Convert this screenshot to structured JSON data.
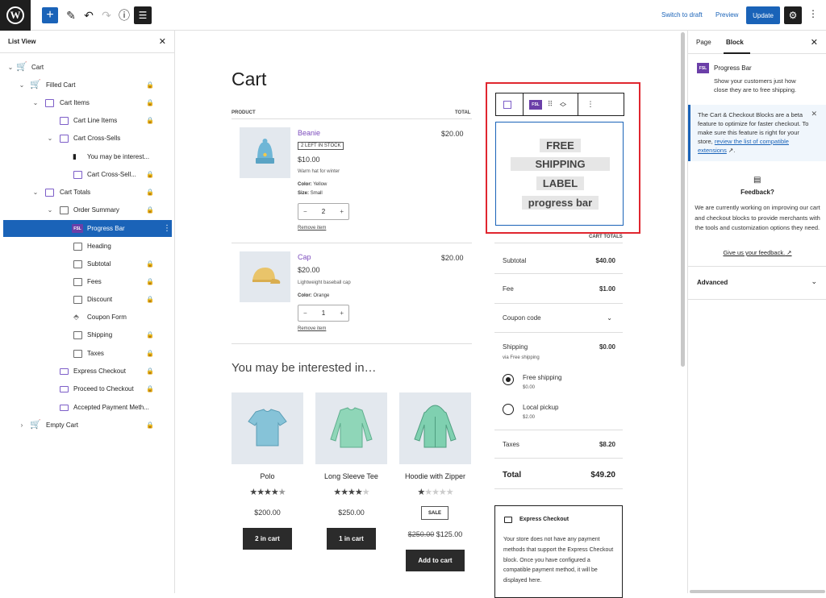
{
  "toolbar": {
    "switch_to_draft": "Switch to draft",
    "preview": "Preview",
    "update": "Update"
  },
  "list_view": {
    "title": "List View",
    "items": [
      {
        "label": "Cart"
      },
      {
        "label": "Filled Cart"
      },
      {
        "label": "Cart Items"
      },
      {
        "label": "Cart Line Items"
      },
      {
        "label": "Cart Cross-Sells"
      },
      {
        "label": "You may be interest..."
      },
      {
        "label": "Cart Cross-Sell..."
      },
      {
        "label": "Cart Totals"
      },
      {
        "label": "Order Summary"
      },
      {
        "label": "Progress Bar",
        "icon_text": "FSL"
      },
      {
        "label": "Heading"
      },
      {
        "label": "Subtotal"
      },
      {
        "label": "Fees"
      },
      {
        "label": "Discount"
      },
      {
        "label": "Coupon Form"
      },
      {
        "label": "Shipping"
      },
      {
        "label": "Taxes"
      },
      {
        "label": "Express Checkout"
      },
      {
        "label": "Proceed to Checkout"
      },
      {
        "label": "Accepted Payment Meth..."
      },
      {
        "label": "Empty Cart"
      }
    ]
  },
  "cart": {
    "title": "Cart",
    "header_product": "PRODUCT",
    "header_total": "TOTAL",
    "items": [
      {
        "name": "Beanie",
        "badge": "2 LEFT IN STOCK",
        "price": "$10.00",
        "desc": "Warm hat for winter",
        "attr1_key": "Color:",
        "attr1_val": "Yellow",
        "attr2_key": "Size:",
        "attr2_val": "Small",
        "qty": "2",
        "remove": "Remove item",
        "total": "$20.00"
      },
      {
        "name": "Cap",
        "price": "$20.00",
        "desc": "Lightweight baseball cap",
        "attr1_key": "Color:",
        "attr1_val": "Orange",
        "qty": "1",
        "remove": "Remove item",
        "total": "$20.00"
      }
    ],
    "qty_minus": "−",
    "qty_plus": "+"
  },
  "cross_sells": {
    "title": "You may be interested in…",
    "products": [
      {
        "name": "Polo",
        "rating": 4.5,
        "price": "$200.00",
        "button": "2 in cart"
      },
      {
        "name": "Long Sleeve Tee",
        "rating": 4,
        "price": "$250.00",
        "button": "1 in cart"
      },
      {
        "name": "Hoodie with Zipper",
        "rating": 1,
        "sale_badge": "SALE",
        "old_price": "$250.00",
        "price": "$125.00",
        "button": "Add to cart"
      }
    ]
  },
  "block_toolbar": {
    "icon_text": "FSL"
  },
  "progress_bar": {
    "lines": [
      "FREE",
      "SHIPPING",
      "LABEL",
      "progress bar"
    ]
  },
  "totals": {
    "heading": "CART TOTALS",
    "subtotal_label": "Subtotal",
    "subtotal": "$40.00",
    "fee_label": "Fee",
    "fee": "$1.00",
    "coupon_label": "Coupon code",
    "shipping_label": "Shipping",
    "shipping": "$0.00",
    "shipping_sub": "via Free shipping",
    "options": [
      {
        "label": "Free shipping",
        "price": "$0.00",
        "selected": true
      },
      {
        "label": "Local pickup",
        "price": "$2.00",
        "selected": false
      }
    ],
    "taxes_label": "Taxes",
    "taxes": "$8.20",
    "total_label": "Total",
    "total": "$49.20"
  },
  "express": {
    "title": "Express Checkout",
    "text": "Your store does not have any payment methods that support the Express Checkout block. Once you have configured a compatible payment method, it will be displayed here."
  },
  "sidebar": {
    "tab_page": "Page",
    "tab_block": "Block",
    "block_icon_text": "FSL",
    "block_title": "Progress Bar",
    "block_desc": "Show your customers just how close they are to free shipping.",
    "notice_text": "The Cart & Checkout Blocks are a beta feature to optimize for faster checkout. To make sure this feature is right for your store,",
    "notice_link": "review the list of compatible extensions",
    "feedback_title": "Feedback?",
    "feedback_text": "We are currently working on improving our cart and checkout blocks to provide merchants with the tools and customization options they need.",
    "feedback_link": "Give us your feedback.",
    "advanced": "Advanced"
  },
  "colors": {
    "accent": "#1a63b8",
    "plugin": "#6b3fa8",
    "highlight_border": "#e0262f",
    "product_link": "#7d4dbd"
  }
}
